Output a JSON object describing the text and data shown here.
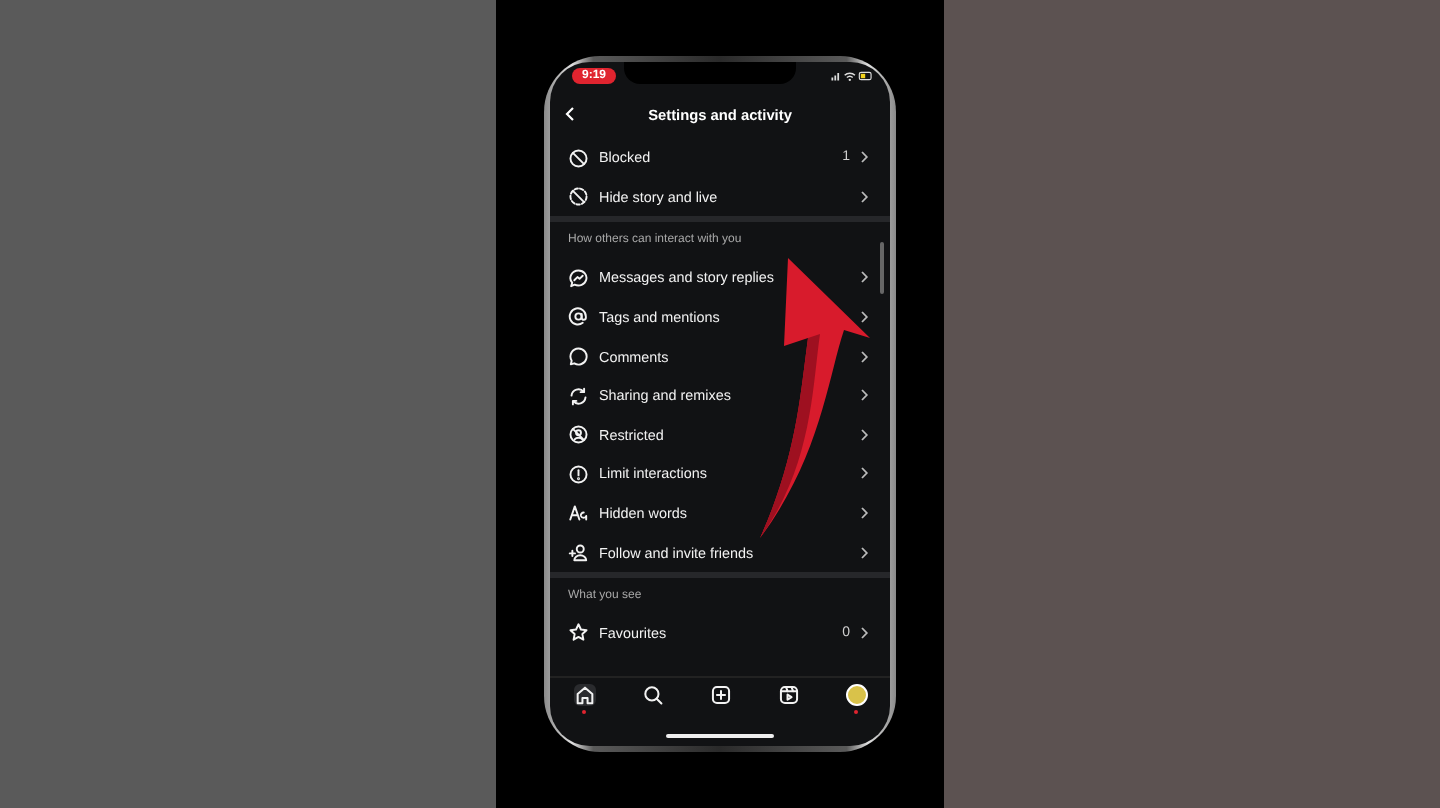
{
  "status_bar": {
    "time": "9:19"
  },
  "header": {
    "title": "Settings and activity"
  },
  "sections": [
    {
      "items": [
        {
          "label": "Blocked",
          "count": "1"
        },
        {
          "label": "Hide story and live"
        }
      ]
    },
    {
      "heading": "How others can interact with you",
      "items": [
        {
          "label": "Messages and story replies"
        },
        {
          "label": "Tags and mentions"
        },
        {
          "label": "Comments"
        },
        {
          "label": "Sharing and remixes"
        },
        {
          "label": "Restricted"
        },
        {
          "label": "Limit interactions"
        },
        {
          "label": "Hidden words"
        },
        {
          "label": "Follow and invite friends"
        }
      ]
    },
    {
      "heading": "What you see",
      "items": [
        {
          "label": "Favourites",
          "count": "0"
        }
      ]
    }
  ],
  "tab_bar": [
    {
      "selected": true,
      "dot": true
    },
    {
      "selected": false,
      "dot": false
    },
    {
      "selected": false,
      "dot": false
    },
    {
      "selected": false,
      "dot": false
    },
    {
      "selected": false,
      "dot": true
    }
  ]
}
